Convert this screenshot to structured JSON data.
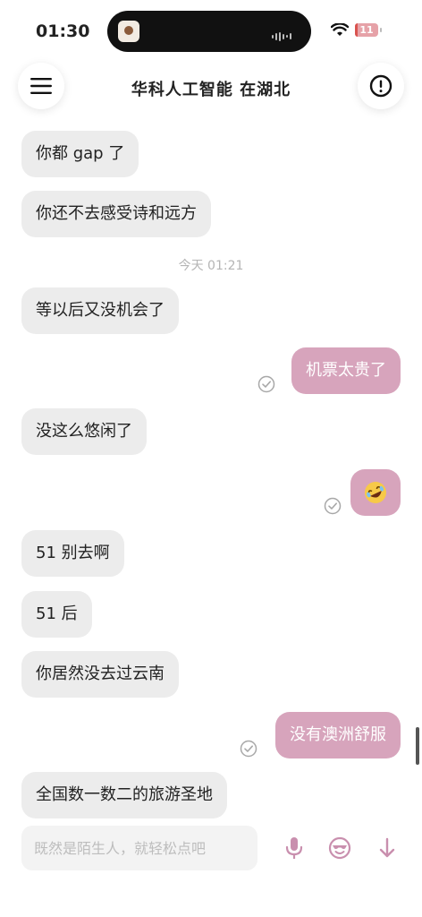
{
  "status_bar": {
    "time": "01:30",
    "battery": "11",
    "battery_level_percent": 11
  },
  "header": {
    "title": "华科人工智能 在湖北"
  },
  "timestamp": "今天 01:21",
  "messages": [
    {
      "side": "in",
      "text": "你都 gap 了"
    },
    {
      "side": "in",
      "text": "你还不去感受诗和远方"
    },
    {
      "side": "in",
      "text": "等以后又没机会了"
    },
    {
      "side": "out",
      "text": "机票太贵了",
      "read": true
    },
    {
      "side": "in",
      "text": "没这么悠闲了"
    },
    {
      "side": "out",
      "text": "",
      "emoji": "rolling-on-floor-laughing-emoji",
      "read": true
    },
    {
      "side": "in",
      "text": "51 别去啊"
    },
    {
      "side": "in",
      "text": "51 后"
    },
    {
      "side": "in",
      "text": "你居然没去过云南"
    },
    {
      "side": "out",
      "text": "没有澳洲舒服",
      "read": true
    },
    {
      "side": "in",
      "text": "全国数一数二的旅游圣地"
    }
  ],
  "composer": {
    "placeholder": "既然是陌生人，就轻松点吧",
    "value": ""
  },
  "colors": {
    "outgoing_bubble": "#d7a4bc",
    "incoming_bubble": "#ececec",
    "accent": "#c98fae"
  }
}
